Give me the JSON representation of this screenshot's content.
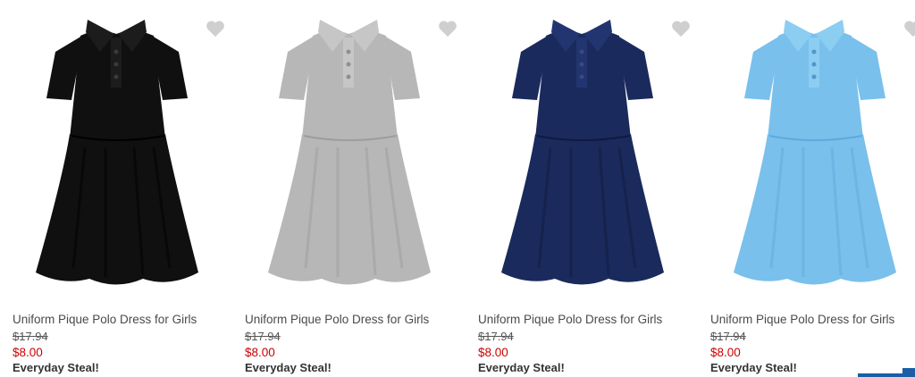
{
  "products": [
    {
      "title": "Uniform Pique Polo Dress for Girls",
      "original_price": "$17.94",
      "sale_price": "$8.00",
      "promo": "Everyday Steal!",
      "color": "#101010",
      "shade": "#000000",
      "placket": "#1c1c1c",
      "button": "#3a3a3a",
      "icon": "heart-icon"
    },
    {
      "title": "Uniform Pique Polo Dress for Girls",
      "original_price": "$17.94",
      "sale_price": "$8.00",
      "promo": "Everyday Steal!",
      "color": "#b7b7b7",
      "shade": "#9d9d9d",
      "placket": "#c6c6c6",
      "button": "#8f8f8f",
      "icon": "heart-icon"
    },
    {
      "title": "Uniform Pique Polo Dress for Girls",
      "original_price": "$17.94",
      "sale_price": "$8.00",
      "promo": "Everyday Steal!",
      "color": "#1a2a5c",
      "shade": "#0f1a3f",
      "placket": "#233570",
      "button": "#3a4a7c",
      "icon": "heart-icon"
    },
    {
      "title": "Uniform Pique Polo Dress for Girls",
      "original_price": "$17.94",
      "sale_price": "$8.00",
      "promo": "Everyday Steal!",
      "color": "#79c0ec",
      "shade": "#5fa9dc",
      "placket": "#8ccdf2",
      "button": "#4f97c8",
      "icon": "heart-icon"
    }
  ],
  "colors": {
    "heart": "#cfcfcf",
    "sale": "#cc0000",
    "corner_tab": "#1a5fa6"
  }
}
